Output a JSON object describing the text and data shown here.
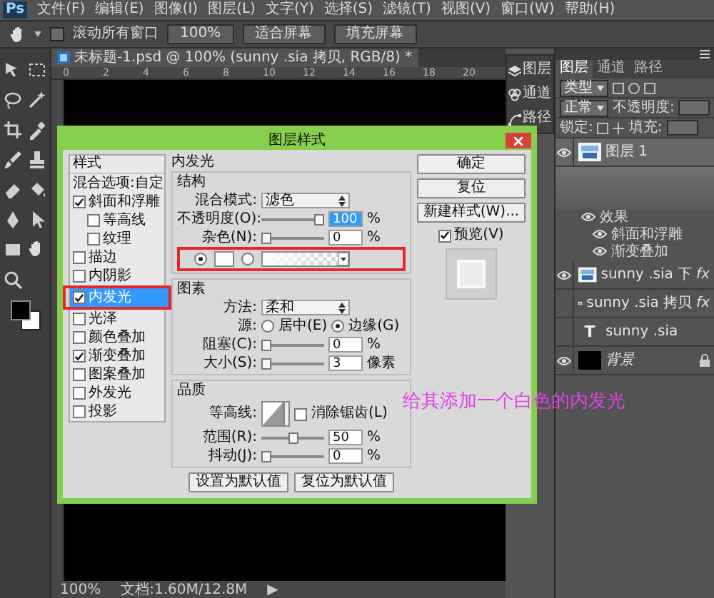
{
  "menu_bar": {
    "logo": "Ps",
    "items": [
      "文件(F)",
      "编辑(E)",
      "图像(I)",
      "图层(L)",
      "文字(Y)",
      "选择(S)",
      "滤镜(T)",
      "视图(V)",
      "窗口(W)",
      "帮助(H)"
    ]
  },
  "options_bar": {
    "scroll_all_windows": {
      "label": "滚动所有窗口",
      "checked": false
    },
    "buttons": [
      "100%",
      "适合屏幕",
      "填充屏幕"
    ]
  },
  "document": {
    "tab_title": "未标题-1.psd @ 100% (sunny .sia 拷贝, RGB/8) *",
    "ruler_labels": [
      "0",
      "2",
      "4",
      "6",
      "8",
      "10",
      "12",
      "14",
      "16",
      "18",
      "20"
    ]
  },
  "mini_panel": {
    "items": [
      {
        "label": "图层",
        "kind": "layers"
      },
      {
        "label": "通道",
        "kind": "channels"
      },
      {
        "label": "路径",
        "kind": "paths"
      }
    ]
  },
  "layers_panel": {
    "tabs": [
      {
        "label": "图层",
        "selected": true
      },
      {
        "label": "通道",
        "selected": false
      },
      {
        "label": "路径",
        "selected": false
      }
    ],
    "filter": "类型",
    "blend_mode": "正常",
    "opacity_label": "不透明度:",
    "lock_label": "锁定:",
    "fill_label": "填充:",
    "layers": [
      {
        "name": "图层 1",
        "kind": "image",
        "visible": true,
        "selected": true,
        "effects": {
          "label": "效果",
          "visible": true,
          "children": [
            {
              "label": "斜面和浮雕",
              "visible": true
            },
            {
              "label": "渐变叠加",
              "visible": true
            }
          ]
        }
      },
      {
        "name": "sunny .sia 下",
        "kind": "image",
        "visible": true,
        "selected": false,
        "fx": "fx"
      },
      {
        "name": "sunny .sia 拷贝",
        "kind": "image",
        "visible": false,
        "selected": false,
        "fx": "fx"
      },
      {
        "name": "sunny .sia",
        "kind": "text",
        "glyph": "T",
        "visible": false,
        "selected": false
      },
      {
        "name": "背景",
        "kind": "fill",
        "visible": true,
        "selected": false,
        "locked": true
      }
    ]
  },
  "layer_style_dialog": {
    "title": "图层样式",
    "styles": [
      {
        "label": "样式",
        "kind": "header"
      },
      {
        "label": "混合选项:自定",
        "kind": "option",
        "selected": false
      },
      {
        "label": "斜面和浮雕",
        "kind": "effect",
        "checked": true,
        "selected": false,
        "children": [
          {
            "label": "等高线",
            "kind": "effect",
            "checked": false,
            "selected": false
          },
          {
            "label": "纹理",
            "kind": "effect",
            "checked": false,
            "selected": false
          }
        ]
      },
      {
        "label": "描边",
        "kind": "effect",
        "checked": false,
        "selected": false
      },
      {
        "label": "内阴影",
        "kind": "effect",
        "checked": false,
        "selected": false
      },
      {
        "label": "内发光",
        "kind": "effect",
        "checked": true,
        "selected": true,
        "annotated": true
      },
      {
        "label": "光泽",
        "kind": "effect",
        "checked": false,
        "selected": false
      },
      {
        "label": "颜色叠加",
        "kind": "effect",
        "checked": false,
        "selected": false
      },
      {
        "label": "渐变叠加",
        "kind": "effect",
        "checked": true,
        "selected": false
      },
      {
        "label": "图案叠加",
        "kind": "effect",
        "checked": false,
        "selected": false
      },
      {
        "label": "外发光",
        "kind": "effect",
        "checked": false,
        "selected": false
      },
      {
        "label": "投影",
        "kind": "effect",
        "checked": false,
        "selected": false
      }
    ],
    "inner_glow": {
      "heading": "内发光",
      "structure": {
        "legend": "结构",
        "blend_mode": {
          "label": "混合模式:",
          "value": "滤色"
        },
        "opacity": {
          "label": "不透明度(O):",
          "level": 1,
          "value": "100",
          "unit": "%",
          "selected": true
        },
        "noise": {
          "label": "杂色(N):",
          "level": 0,
          "value": "0",
          "unit": "%"
        },
        "fill": {
          "annotated": true,
          "color_option": {
            "selected": true,
            "color": "#ffffff"
          },
          "gradient_option": {
            "selected": false
          }
        }
      },
      "elements": {
        "legend": "图素",
        "technique": {
          "label": "方法:",
          "value": "柔和"
        },
        "source": {
          "label": "源:",
          "options": [
            {
              "label": "居中(E)",
              "selected": false
            },
            {
              "label": "边缘(G)",
              "selected": true
            }
          ]
        },
        "choke": {
          "label": "阻塞(C):",
          "level": 0,
          "value": "0",
          "unit": "%"
        },
        "size": {
          "label": "大小(S):",
          "level": 0.01,
          "value": "3",
          "unit": "像素"
        }
      },
      "quality": {
        "legend": "品质",
        "contour": {
          "label": "等高线:"
        },
        "anti_alias": {
          "label": "消除锯齿(L)",
          "checked": false
        },
        "range": {
          "label": "范围(R):",
          "level": 0.5,
          "value": "50",
          "unit": "%"
        },
        "jitter": {
          "label": "抖动(J):",
          "level": 0,
          "value": "0",
          "unit": "%"
        }
      },
      "buttons": [
        "设置为默认值",
        "复位为默认值"
      ]
    },
    "side_buttons": [
      "确定",
      "复位",
      "新建样式(W)..."
    ],
    "preview": {
      "label": "预览(V)",
      "checked": true
    }
  },
  "annotation": {
    "text": "给其添加一个白色的内发光"
  },
  "status_bar": {
    "zoom": "100%",
    "doc_info": "文档:1.60M/12.8M",
    "arrow": "▶"
  }
}
